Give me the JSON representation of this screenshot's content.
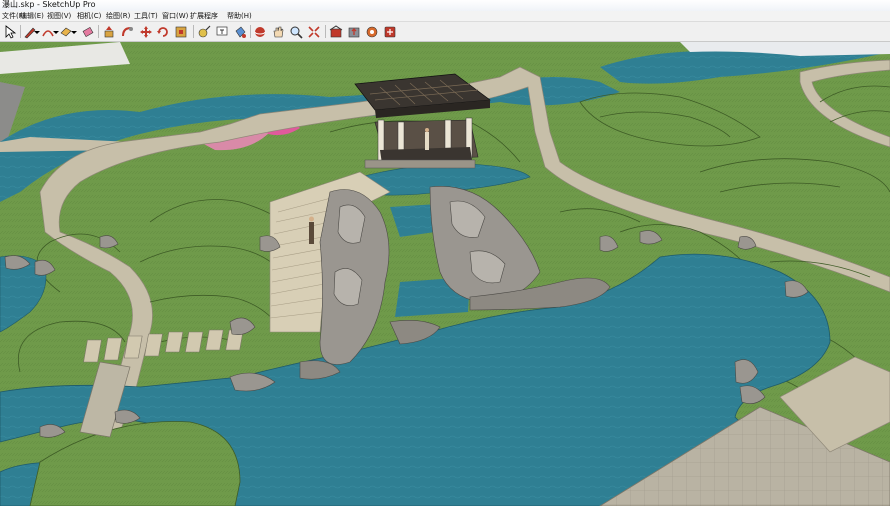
{
  "window": {
    "title": "瀑山.skp - SketchUp Pro"
  },
  "menu": {
    "items": [
      {
        "label": "文件(F)"
      },
      {
        "label": "编辑(E)"
      },
      {
        "label": "视图(V)"
      },
      {
        "label": "相机(C)"
      },
      {
        "label": "绘图(R)"
      },
      {
        "label": "工具(T)"
      },
      {
        "label": "窗口(W)"
      },
      {
        "label": "扩展程序"
      },
      {
        "label": "帮助(H)"
      }
    ]
  },
  "toolbar": {
    "tools": [
      "select-tool",
      "eraser-tool",
      "line-tool",
      "line-dropdown",
      "arc-tool",
      "arc-dropdown",
      "rectangle-tool",
      "rectangle-dropdown",
      "push-pull-tool",
      "move-tool",
      "rotate-tool",
      "scale-tool",
      "offset-tool",
      "tape-measure-tool",
      "text-tool",
      "paint-bucket-tool",
      "orbit-tool",
      "pan-tool",
      "zoom-tool",
      "zoom-extents-tool",
      "warehouse-tool",
      "extension-warehouse-tool",
      "components-tool",
      "layout-tool"
    ]
  },
  "scene": {
    "description_colors": {
      "grass": "#6f9a4a",
      "water": "#2f7f93",
      "path": "#c7bfa9",
      "paving": "#b9b3a3",
      "rock": "#9a9690",
      "roof": "#3a3530"
    }
  }
}
